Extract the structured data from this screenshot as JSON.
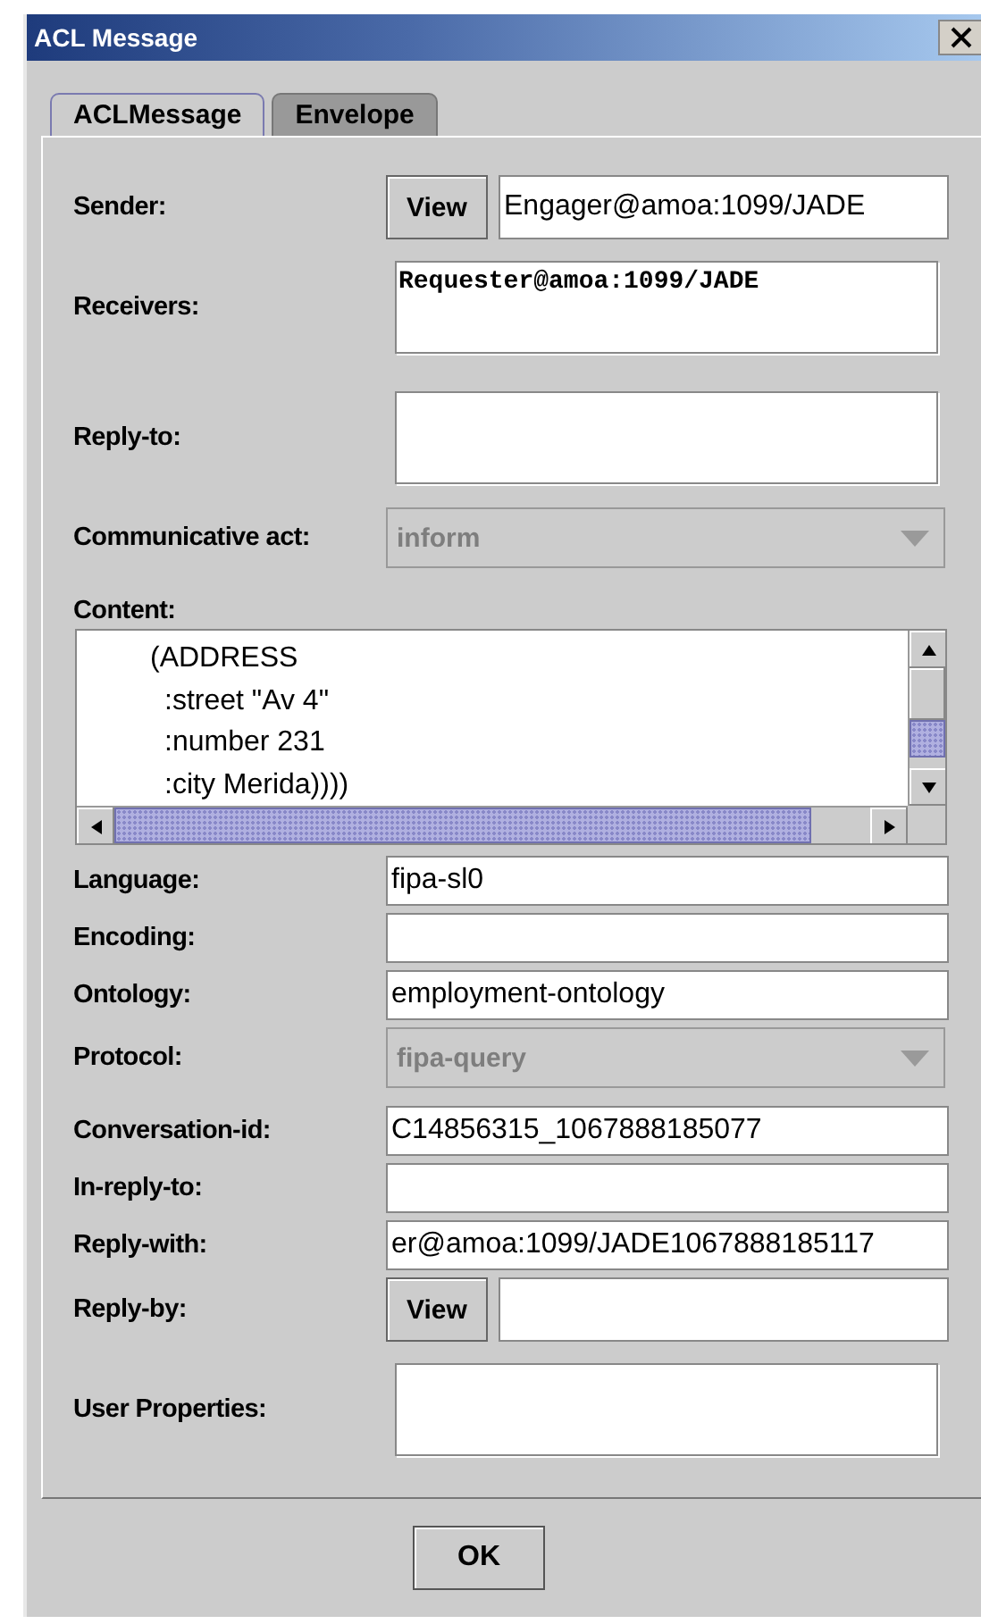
{
  "window": {
    "title": "ACL Message"
  },
  "tabs": [
    {
      "label": "ACLMessage",
      "selected": true
    },
    {
      "label": "Envelope",
      "selected": false
    }
  ],
  "fields": [
    {
      "kind": "view_text",
      "label": "Sender:",
      "button": "View",
      "value": "Engager@amoa:1099/JADE"
    },
    {
      "kind": "agent_list",
      "label": "Receivers:",
      "values": [
        "Requester@amoa:1099/JADE"
      ]
    },
    {
      "kind": "agent_list",
      "label": "Reply-to:"
    },
    {
      "kind": "combo",
      "label": "Communicative act:",
      "value": "inform",
      "disabled": true
    },
    {
      "kind": "content",
      "label": "Content:",
      "lines": [
        {
          "text": "(ADDRESS",
          "children": [
            {
              "text": ":street \"Av 4\""
            },
            {
              "text": ":number 231"
            },
            {
              "text": ":city Merida))))"
            }
          ]
        }
      ]
    },
    {
      "kind": "text",
      "label": "Language:",
      "value": "fipa-sl0"
    },
    {
      "kind": "text",
      "label": "Encoding:"
    },
    {
      "kind": "text",
      "label": "Ontology:",
      "value": "employment-ontology"
    },
    {
      "kind": "combo",
      "label": "Protocol:",
      "value": "fipa-query",
      "disabled": true
    },
    {
      "kind": "text",
      "label": "Conversation-id:",
      "value": "C14856315_1067888185077"
    },
    {
      "kind": "text",
      "label": "In-reply-to:"
    },
    {
      "kind": "text",
      "label": "Reply-with:",
      "value": "er@amoa:1099/JADE1067888185117"
    },
    {
      "kind": "view_text",
      "label": "Reply-by:",
      "button": "View"
    },
    {
      "kind": "props",
      "label": "User Properties:"
    }
  ],
  "buttons": [
    "OK"
  ]
}
